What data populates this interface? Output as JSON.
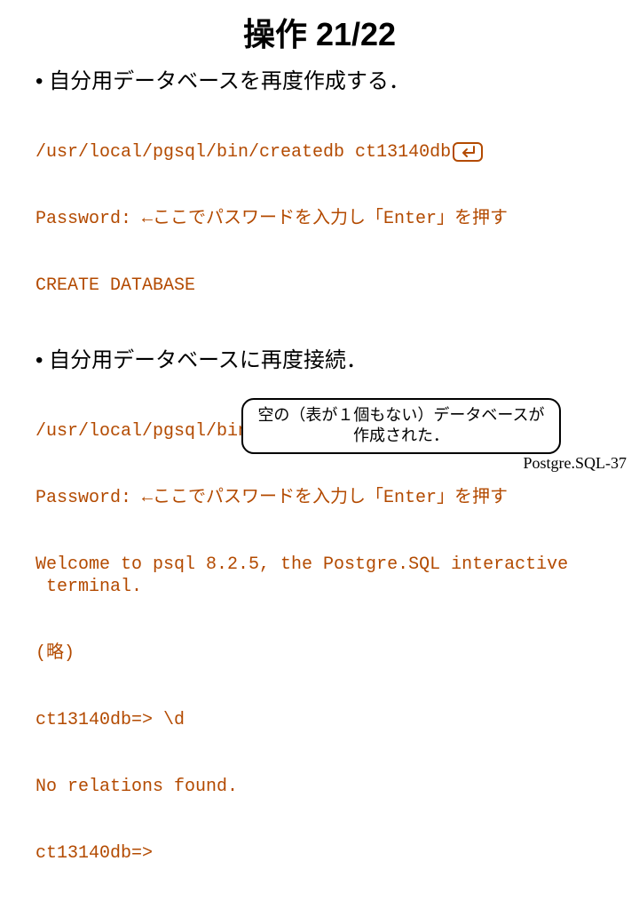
{
  "title": "操作 21/22",
  "bullet1": "• 自分用データベースを再度作成する．",
  "code1": {
    "l1a": "/usr/local/pgsql/bin/createdb ct13140db",
    "l2": "Password: ←ここでパスワードを入力し「Enter」を押す",
    "l3": "CREATE DATABASE"
  },
  "bullet2": "• 自分用データベースに再度接続．",
  "code2": {
    "l1a": "/usr/local/pgsql/bin/psql ct13140db",
    "l2": "Password: ←ここでパスワードを入力し「Enter」を押す",
    "l3": "Welcome to psql 8.2.5, the Postgre.SQL interactive\n terminal.",
    "l4": "(略)",
    "l5": "ct13140db=> \\d",
    "l6": "No relations found.",
    "l7": "ct13140db=>"
  },
  "callout": "空の（表が１個もない）データベースが\n作成された．",
  "footer": "Postgre.SQL-37",
  "icons": {
    "enter": "enter-key-icon"
  }
}
